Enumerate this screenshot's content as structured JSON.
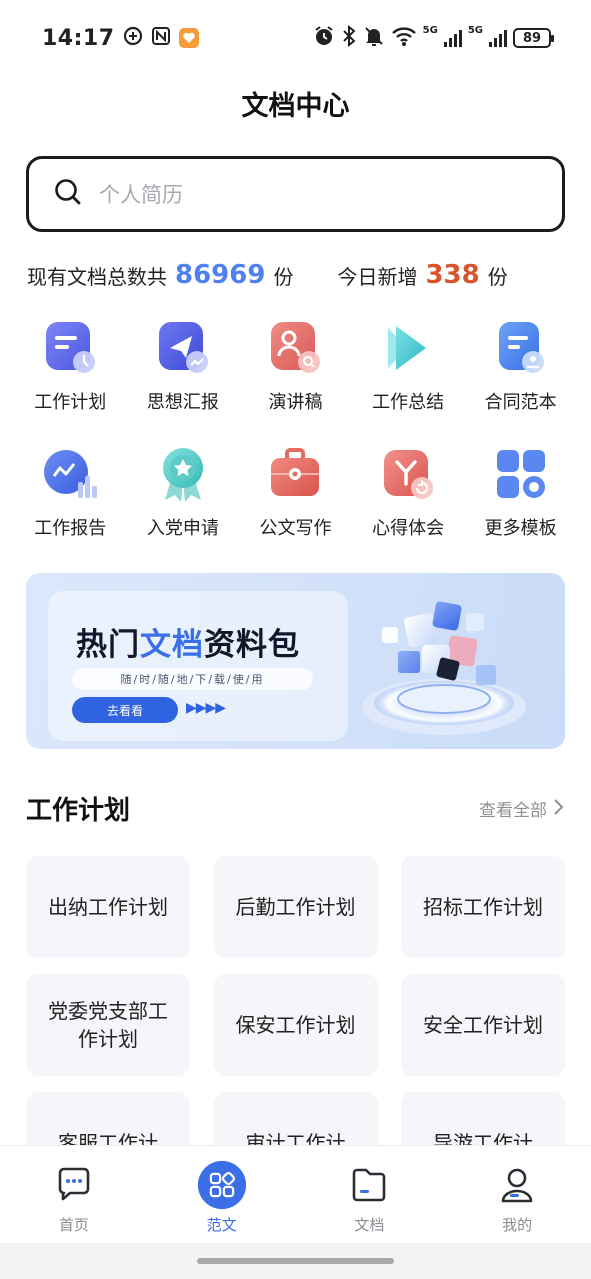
{
  "status_bar": {
    "time": "14:17",
    "network_1": "5G",
    "network_2": "5G",
    "battery": "89"
  },
  "header": {
    "title": "文档中心"
  },
  "search": {
    "placeholder": "个人简历"
  },
  "stats": {
    "total_prefix": "现有文档总数共",
    "total_count": "86969",
    "total_unit": "份",
    "today_prefix": "今日新增",
    "today_count": "338",
    "today_unit": "份"
  },
  "categories": [
    {
      "label": "工作计划",
      "icon": "work-plan-icon"
    },
    {
      "label": "思想汇报",
      "icon": "thought-report-icon"
    },
    {
      "label": "演讲稿",
      "icon": "speech-icon"
    },
    {
      "label": "工作总结",
      "icon": "work-summary-icon"
    },
    {
      "label": "合同范本",
      "icon": "contract-icon"
    },
    {
      "label": "工作报告",
      "icon": "work-report-icon"
    },
    {
      "label": "入党申请",
      "icon": "party-application-icon"
    },
    {
      "label": "公文写作",
      "icon": "official-writing-icon"
    },
    {
      "label": "心得体会",
      "icon": "experience-icon"
    },
    {
      "label": "更多模板",
      "icon": "more-templates-icon"
    }
  ],
  "banner": {
    "title_part1": "热门",
    "title_highlight": "文档",
    "title_part2": "资料包",
    "subtitle": "随/时/随/地/下/载/使/用",
    "button": "去看看",
    "arrows": "▶▶▶▶"
  },
  "section": {
    "title": "工作计划",
    "more": "查看全部"
  },
  "documents": [
    {
      "title": "出纳工作计划"
    },
    {
      "title": "后勤工作计划"
    },
    {
      "title": "招标工作计划"
    },
    {
      "title": "党委党支部工作计划"
    },
    {
      "title": "保安工作计划"
    },
    {
      "title": "安全工作计划"
    },
    {
      "title": "客服工作计"
    },
    {
      "title": "审计工作计"
    },
    {
      "title": "导游工作计"
    }
  ],
  "nav": [
    {
      "label": "首页",
      "icon": "home-icon",
      "active": false
    },
    {
      "label": "范文",
      "icon": "templates-icon",
      "active": true
    },
    {
      "label": "文档",
      "icon": "folder-icon",
      "active": false
    },
    {
      "label": "我的",
      "icon": "profile-icon",
      "active": false
    }
  ],
  "colors": {
    "accent": "#3a6fe8",
    "total_count": "#4f80f0",
    "today_count": "#d9532d"
  }
}
